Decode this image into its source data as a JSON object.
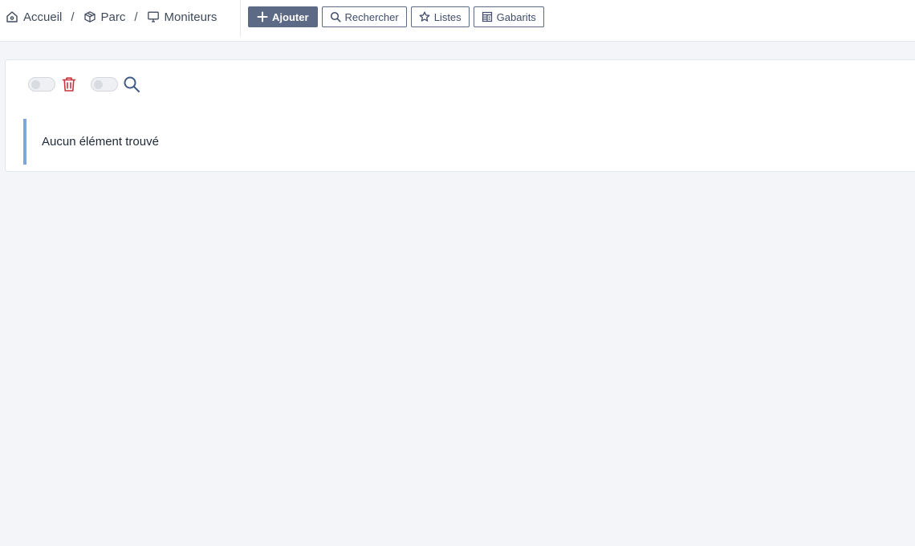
{
  "breadcrumb": {
    "items": [
      {
        "label": "Accueil",
        "icon": "home-icon"
      },
      {
        "label": "Parc",
        "icon": "box-icon"
      },
      {
        "label": "Moniteurs",
        "icon": "monitor-icon"
      }
    ],
    "separator": "/"
  },
  "toolbar": {
    "add_label": "Ajouter",
    "search_label": "Rechercher",
    "lists_label": "Listes",
    "templates_label": "Gabarits"
  },
  "list": {
    "empty_message": "Aucun élément trouvé",
    "delete_toggle": {
      "on": false,
      "icon": "trash-icon"
    },
    "search_toggle": {
      "on": false,
      "icon": "search-icon"
    }
  },
  "colors": {
    "primary": "#5c6a86",
    "danger": "#c8333d",
    "info_border": "#7da7da",
    "background": "#f4f5f9"
  }
}
